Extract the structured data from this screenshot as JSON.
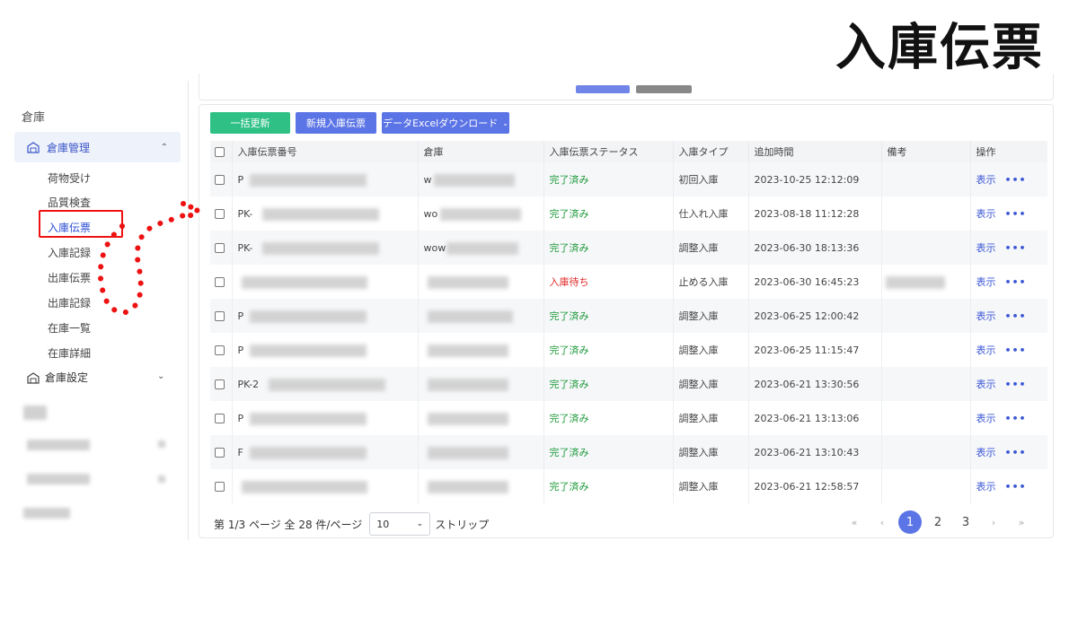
{
  "overlay_title": "入庫伝票",
  "sidebar": {
    "heading": "倉庫",
    "group_label": "倉庫管理",
    "items": [
      {
        "label": "荷物受け"
      },
      {
        "label": "品質検査"
      },
      {
        "label": "入庫伝票"
      },
      {
        "label": "入庫記録"
      },
      {
        "label": "出庫伝票"
      },
      {
        "label": "出庫記録"
      },
      {
        "label": "在庫一覧"
      },
      {
        "label": "在庫詳細"
      }
    ],
    "group2_label": "倉庫設定"
  },
  "toolbar": {
    "bulk_update": "一括更新",
    "new_receipt": "新規入庫伝票",
    "excel_download": "データExcelダウンロード"
  },
  "table": {
    "headers": [
      "入庫伝票番号",
      "倉庫",
      "入庫伝票ステータス",
      "入庫タイプ",
      "追加時間",
      "備考",
      "操作"
    ],
    "rows": [
      {
        "id": "P",
        "wh": "w",
        "status": "完了済み",
        "type": "初回入庫",
        "time": "2023-10-25 12:12:09",
        "action": "表示"
      },
      {
        "id": "PK-",
        "wh": "wo",
        "status": "完了済み",
        "type": "仕入れ入庫",
        "time": "2023-08-18 11:12:28",
        "action": "表示"
      },
      {
        "id": "PK-",
        "wh": "wow",
        "status": "完了済み",
        "type": "調整入庫",
        "time": "2023-06-30 18:13:36",
        "action": "表示"
      },
      {
        "id": "",
        "wh": "",
        "status": "入庫待ち",
        "type": "止める入庫",
        "time": "2023-06-30 16:45:23",
        "action": "表示"
      },
      {
        "id": "P",
        "wh": "",
        "status": "完了済み",
        "type": "調整入庫",
        "time": "2023-06-25 12:00:42",
        "action": "表示"
      },
      {
        "id": "P",
        "wh": "",
        "status": "完了済み",
        "type": "調整入庫",
        "time": "2023-06-25 11:15:47",
        "action": "表示"
      },
      {
        "id": "PK-2",
        "wh": "",
        "status": "完了済み",
        "type": "調整入庫",
        "time": "2023-06-21 13:30:56",
        "action": "表示"
      },
      {
        "id": "P",
        "wh": "",
        "status": "完了済み",
        "type": "調整入庫",
        "time": "2023-06-21 13:13:06",
        "action": "表示"
      },
      {
        "id": "F",
        "wh": "",
        "status": "完了済み",
        "type": "調整入庫",
        "time": "2023-06-21 13:10:43",
        "action": "表示"
      },
      {
        "id": "",
        "wh": "",
        "status": "完了済み",
        "type": "調整入庫",
        "time": "2023-06-21 12:58:57",
        "action": "表示"
      }
    ]
  },
  "pagination": {
    "summary": "第 1/3 ページ 全 28 件/ページ",
    "page_size": "10",
    "strip_label": "ストリップ",
    "first": "«",
    "prev": "‹",
    "pages": [
      "1",
      "2",
      "3"
    ],
    "next": "›",
    "last": "»"
  },
  "colors": {
    "primary": "#5b74e6",
    "success_button": "#2fc086",
    "status_done": "#1d9a3a",
    "status_wait": "#e02828",
    "annotation": "#e11"
  }
}
